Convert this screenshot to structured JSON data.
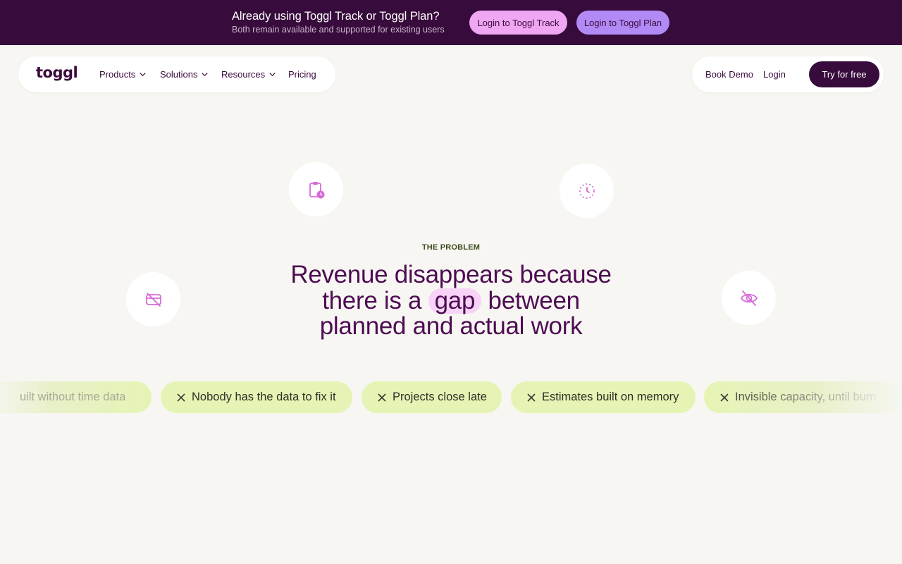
{
  "announcement": {
    "title": "Already using Toggl Track or Toggl Plan?",
    "subtitle": "Both remain available and supported for existing users",
    "track_button": "Login to Toggl Track",
    "plan_button": "Login to Toggl Plan"
  },
  "nav": {
    "logo": "toggl",
    "items": [
      "Products",
      "Solutions",
      "Resources",
      "Pricing"
    ],
    "book_demo": "Book Demo",
    "login": "Login",
    "try_free": "Try for free"
  },
  "hero": {
    "eyebrow": "THE PROBLEM",
    "line1": "Revenue disappears because",
    "line2_before": "there is a",
    "line2_highlight": "gap",
    "line2_after": "between",
    "line3": "planned and actual work"
  },
  "icons": {
    "top_left": "clipboard-clock-icon",
    "top_right": "dashed-clock-icon",
    "mid_left": "no-money-icon",
    "mid_right": "eye-off-icon"
  },
  "chips": [
    "uilt without time data",
    "Nobody has the data to fix it",
    "Projects close late",
    "Estimates built on memory",
    "Invisible capacity, until burn"
  ],
  "colors": {
    "announce_bg": "#370b3b",
    "accent_pink": "#f0a6f2",
    "accent_purple": "#b28af5",
    "chip_bg": "#e5f4b4",
    "headline": "#4e0c53",
    "page_bg": "#f7f6f2"
  }
}
